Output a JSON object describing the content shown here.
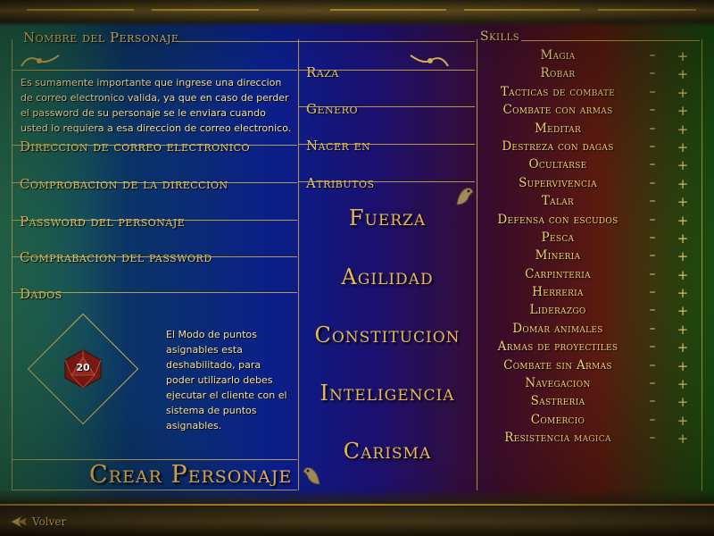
{
  "left_panel": {
    "character_name_label": "Nombre del Personaje",
    "email_notice": "Es sumamente importante que ingrese una direccion de correo electronico valida, ya que en caso de perder el password de su personaje se le enviara cuando usted lo requiera a esa direccion de correo electronico.",
    "email_label": "Direccion de correo electronico",
    "email_confirm_label": "Comprobacion de la direccion",
    "password_label": "Password del personaje",
    "password_confirm_label": "Comprabacion del password",
    "dice_label": "Dados",
    "dice_value": "20",
    "points_notice": "El Modo de puntos asignables esta deshabilitado, para poder utilizarlo debes ejecutar el cliente con el sistema de puntos asignables.",
    "create_button": "Crear Personaje"
  },
  "middle_panel": {
    "race_label": "Raza",
    "gender_label": "Genero",
    "birthplace_label": "Nacer en",
    "attributes_label": "Atributos",
    "attributes": [
      "Fuerza",
      "Agilidad",
      "Constitucion",
      "Inteligencia",
      "Carisma"
    ]
  },
  "skills_panel": {
    "title": "Skills",
    "minus_symbol": "–",
    "plus_symbol": "+",
    "skills": [
      "Magia",
      "Robar",
      "Tacticas de combate",
      "Combate con armas",
      "Meditar",
      "Destreza con dagas",
      "Ocultarse",
      "Supervivencia",
      "Talar",
      "Defensa con escudos",
      "Pesca",
      "Mineria",
      "Carpinteria",
      "Herreria",
      "Liderazgo",
      "Domar animales",
      "Armas de proyectiles",
      "Combate sin Armas",
      "Navegacion",
      "Sastreria",
      "Comercio",
      "Resistencia magica"
    ]
  },
  "footer": {
    "back_button": "Volver"
  },
  "colors": {
    "gold": "#e8c86a",
    "frame": "#c8a84a",
    "dice_red": "#7a1a14"
  }
}
